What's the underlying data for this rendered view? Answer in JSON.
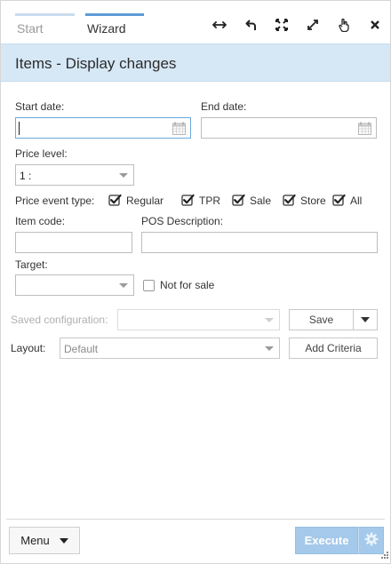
{
  "tabs": [
    {
      "label": "Start"
    },
    {
      "label": "Wizard"
    }
  ],
  "toolbar_icons": [
    "resize-horizontal-icon",
    "undo-icon",
    "fit-screen-icon",
    "expand-icon",
    "pointer-icon",
    "close-icon"
  ],
  "title": "Items - Display changes",
  "form": {
    "start_date_label": "Start date:",
    "start_date_value": "",
    "end_date_label": "End date:",
    "end_date_value": "",
    "price_level_label": "Price level:",
    "price_level_value": "1 :",
    "price_event_type_label": "Price event type:",
    "price_event_types": [
      {
        "label": "Regular",
        "checked": true
      },
      {
        "label": "TPR",
        "checked": true
      },
      {
        "label": "Sale",
        "checked": true
      },
      {
        "label": "Store",
        "checked": true
      },
      {
        "label": "All",
        "checked": true
      }
    ],
    "item_code_label": "Item code:",
    "item_code_value": "",
    "pos_description_label": "POS Description:",
    "pos_description_value": "",
    "target_label": "Target:",
    "target_value": "",
    "not_for_sale_label": "Not for sale",
    "not_for_sale_checked": false,
    "saved_config_label": "Saved configuration:",
    "saved_config_value": "",
    "save_label": "Save",
    "layout_label": "Layout:",
    "layout_value": "Default",
    "add_criteria_label": "Add Criteria"
  },
  "footer": {
    "menu_label": "Menu",
    "execute_label": "Execute"
  },
  "colors": {
    "accent": "#5b9bd5",
    "title_band": "#d6e8f6",
    "execute_button": "#a4c9ea"
  }
}
